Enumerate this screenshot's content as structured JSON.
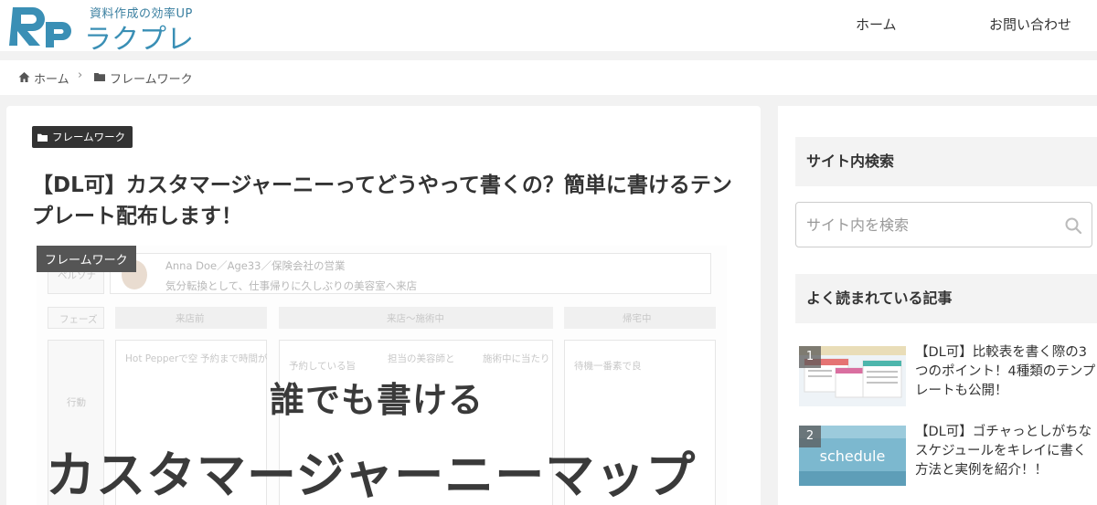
{
  "site": {
    "tagline": "資料作成の効率UP",
    "name": "ラクプレ",
    "logo_letters": "Rp"
  },
  "nav": {
    "home": "ホーム",
    "contact": "お問い合わせ"
  },
  "breadcrumb": {
    "home": "ホーム",
    "separator": "›",
    "category": "フレームワーク"
  },
  "article": {
    "category": "フレームワーク",
    "title": "【DL可】カスタマージャーニーってどうやって書くの？簡単に書けるテンプレート配布します！",
    "eyecatch": {
      "label": "フレームワーク",
      "persona_label": "ペルソナ",
      "persona_name": "Anna Doe／Age33／保険会社の営業",
      "persona_desc": "気分転換として、仕事帰りに久しぶりの美容室へ来店",
      "phase_label": "フェーズ",
      "phases": [
        "来店前",
        "来店～施術中",
        "帰宅中"
      ],
      "action_label": "行動",
      "cells": [
        "Hot Pepperで空",
        "予約まで時間が",
        "予約している旨",
        "担当の美容師と",
        "施術中に当たり",
        "待機一番素で良"
      ],
      "sub_heading": "誰でも書ける",
      "main_heading": "カスタマージャーニーマップ"
    }
  },
  "sidebar": {
    "search_title": "サイト内検索",
    "search_placeholder": "サイト内を検索",
    "popular_title": "よく読まれている記事",
    "popular": [
      {
        "rank": "1",
        "title": "【DL可】比較表を書く際の3つのポイント！4種類のテンプレートも公開！"
      },
      {
        "rank": "2",
        "title": "【DL可】ゴチャっとしがちなスケジュールをキレイに書く方法と実例を紹介！！",
        "thumb_text": "schedule"
      }
    ]
  },
  "colors": {
    "brand": "#3a8fb5",
    "badge_bg": "#333333",
    "widget_bg": "#f3f3f3"
  }
}
